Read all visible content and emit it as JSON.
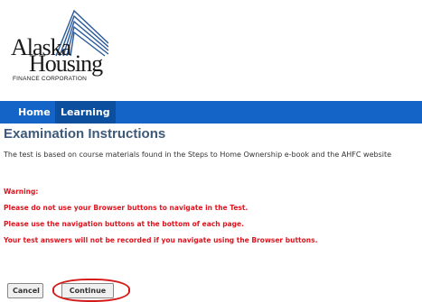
{
  "logo": {
    "line1": "Alaska",
    "line2": "Housing",
    "sub": "FINANCE CORPORATION",
    "icon": "mountain-lines-logo",
    "color": "#2a5a9c"
  },
  "nav": {
    "home": "Home",
    "learning": "Learning",
    "bar_color": "#1464c8"
  },
  "page": {
    "title": "Examination Instructions",
    "intro": "The test is based on course materials found in the Steps to Home Ownership e-book and the AHFC website"
  },
  "warnings": [
    "Warning:",
    "Please do not use your Browser buttons to navigate in the Test.",
    "Please use the navigation buttons at the bottom of each page.",
    "Your test answers will not be recorded if you navigate using the Browser buttons."
  ],
  "buttons": {
    "cancel": "Cancel",
    "continue": "Continue"
  },
  "colors": {
    "warning": "#e0141e",
    "title": "#3d5a7a",
    "highlight": "#d51a1a"
  }
}
